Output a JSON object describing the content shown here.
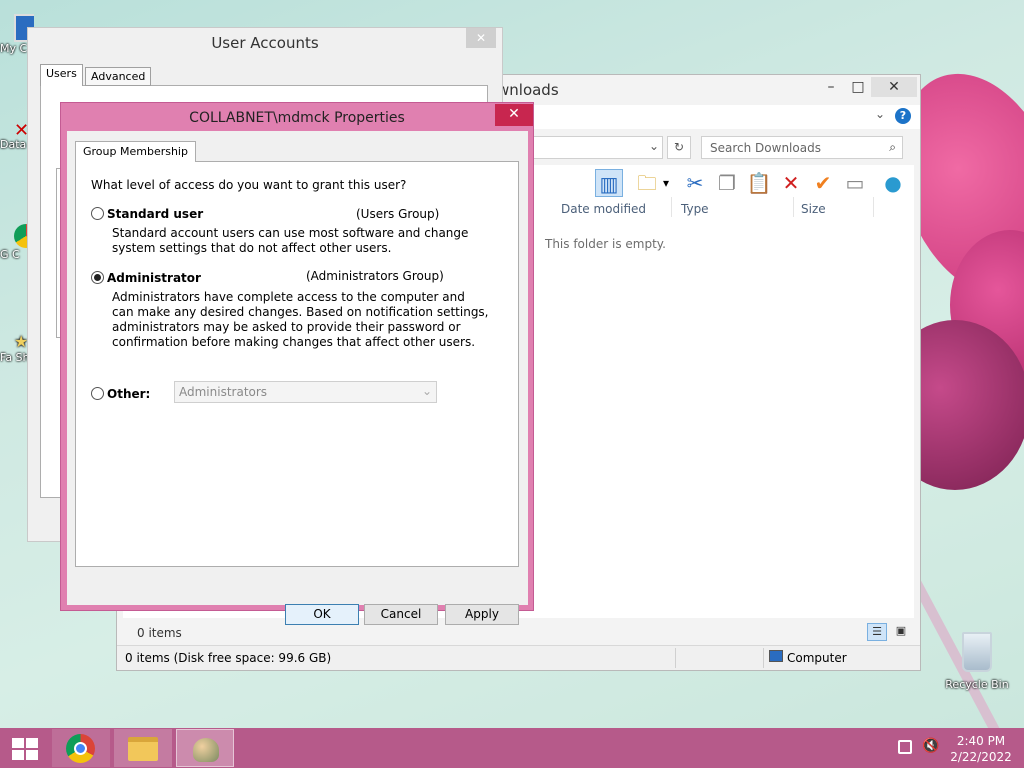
{
  "desktop": {
    "icons": [
      {
        "label": "My C"
      },
      {
        "label": "Data"
      },
      {
        "label": "G C"
      },
      {
        "label": "Fa Sh"
      }
    ],
    "recycle_bin": {
      "label": "Recycle Bin",
      "icon": "recycle-bin-icon"
    }
  },
  "explorer": {
    "title": "wnloads",
    "search_placeholder": "Search Downloads",
    "columns": [
      "Date modified",
      "Type",
      "Size"
    ],
    "empty_message": "This folder is empty.",
    "item_count": "0 items",
    "status_left": "0 items (Disk free space: 99.6 GB)",
    "status_right": "Computer",
    "caption_buttons": {
      "minimize": "–",
      "maximize": "□",
      "close": "✕"
    }
  },
  "user_accounts": {
    "title": "User Accounts",
    "tabs": [
      "Users",
      "Advanced"
    ],
    "close": "✕"
  },
  "properties": {
    "title": "COLLABNET\\mdmck Properties",
    "close": "✕",
    "tab": "Group Membership",
    "question": "What level of access do you want to grant this user?",
    "standard": {
      "label": "Standard user",
      "group": "(Users Group)",
      "desc": [
        "Standard account users can use most software and change",
        "system settings that do not affect other users."
      ],
      "selected": false
    },
    "administrator": {
      "label": "Administrator",
      "group": "(Administrators Group)",
      "desc": [
        "Administrators have complete access to the computer and",
        "can make any desired changes. Based on notification settings,",
        "administrators may be asked to provide their password or",
        "confirmation before making changes that affect other users."
      ],
      "selected": true
    },
    "other": {
      "label": "Other:",
      "select_value": "Administrators",
      "selected": false
    },
    "buttons": {
      "ok": "OK",
      "cancel": "Cancel",
      "apply": "Apply"
    }
  },
  "taskbar": {
    "time": "2:40 PM",
    "date": "2/22/2022",
    "items": [
      "start-button",
      "chrome",
      "file-explorer",
      "user-accounts"
    ]
  },
  "colors": {
    "taskbar": "#b65a8a",
    "dialog_frame": "#e080b0",
    "close_red": "#c8264f"
  }
}
